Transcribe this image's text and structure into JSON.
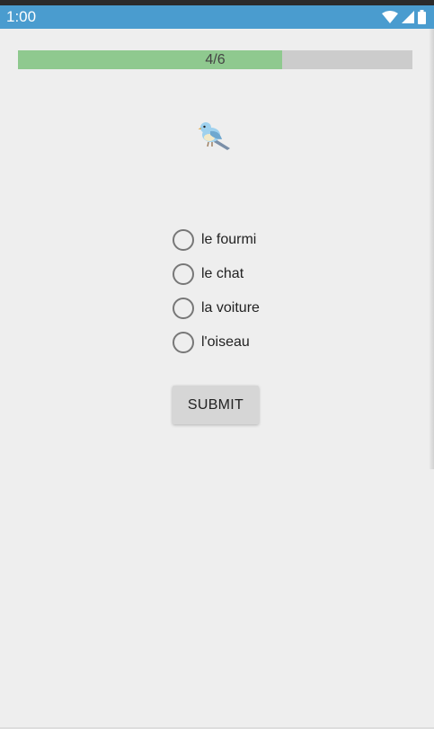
{
  "status_bar": {
    "time": "1:00",
    "icons": [
      "wifi-icon",
      "signal-icon",
      "battery-icon"
    ],
    "color": "#4a9ccf"
  },
  "progress": {
    "label": "4/6",
    "current": 4,
    "total": 6,
    "fraction": 0.67,
    "fill_color": "#8fc98f",
    "track_color": "#cccccc"
  },
  "question": {
    "image_icon": "bird-icon"
  },
  "options": [
    {
      "label": "le fourmi",
      "selected": false
    },
    {
      "label": "le chat",
      "selected": false
    },
    {
      "label": "la voiture",
      "selected": false
    },
    {
      "label": "l'oiseau",
      "selected": false
    }
  ],
  "submit": {
    "label": "SUBMIT"
  }
}
